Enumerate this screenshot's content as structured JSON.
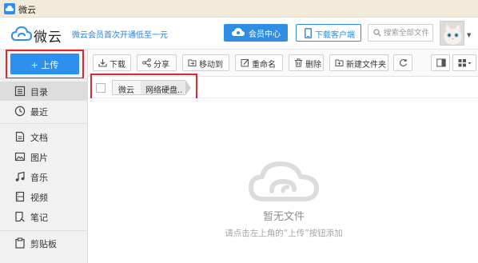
{
  "window": {
    "title": "微云"
  },
  "header": {
    "logo_text": "微云",
    "promo": "微云会员首次开通低至一元",
    "vip_label": "会员中心",
    "download_label": "下载客户端",
    "search_placeholder": "搜索全部文件"
  },
  "sidebar": {
    "upload_label": "+ 上传",
    "items": [
      {
        "label": "目录",
        "icon": "list-icon"
      },
      {
        "label": "最近",
        "icon": "clock-icon"
      },
      {
        "label": "文档",
        "icon": "document-icon"
      },
      {
        "label": "图片",
        "icon": "image-icon"
      },
      {
        "label": "音乐",
        "icon": "music-icon"
      },
      {
        "label": "视频",
        "icon": "video-icon"
      },
      {
        "label": "笔记",
        "icon": "note-icon"
      },
      {
        "label": "剪贴板",
        "icon": "clipboard-icon"
      }
    ]
  },
  "toolbar": {
    "download": "下载",
    "share": "分享",
    "move": "移动到",
    "rename": "重命名",
    "delete": "删除",
    "new_folder": "新建文件夹"
  },
  "breadcrumb": {
    "root": "微云",
    "current": "网络硬盘.."
  },
  "empty_state": {
    "title": "暂无文件",
    "hint": "请点击左上角的“上传”按钮添加"
  },
  "colors": {
    "accent": "#2d8ff0",
    "highlight": "#e0262b",
    "titlebar": "#f3ebd9"
  }
}
